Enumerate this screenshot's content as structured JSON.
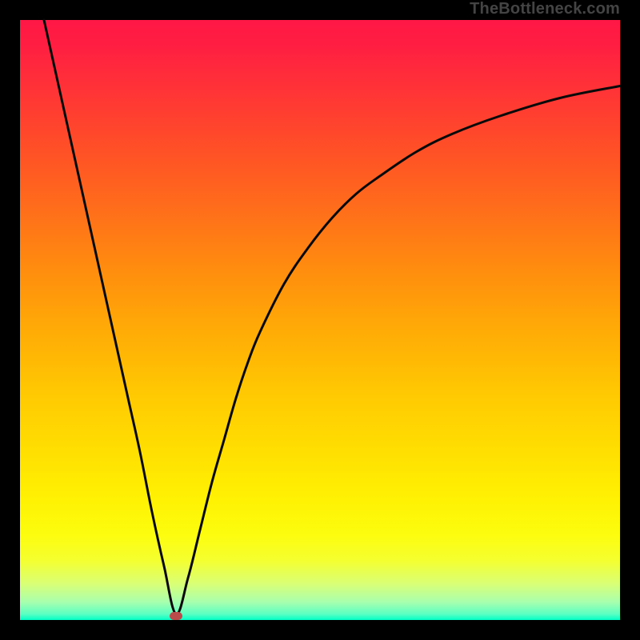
{
  "watermark": {
    "text": "TheBottleneck.com"
  },
  "chart_data": {
    "type": "line",
    "title": "",
    "xlabel": "",
    "ylabel": "",
    "xlim": [
      0,
      100
    ],
    "ylim": [
      0,
      100
    ],
    "grid": false,
    "legend": false,
    "background": "gradient-red-yellow-green-vertical",
    "series": [
      {
        "name": "left-branch",
        "x": [
          4,
          6,
          8,
          10,
          12,
          14,
          16,
          18,
          20,
          22,
          24,
          26
        ],
        "y": [
          100,
          91,
          82,
          73,
          64,
          55,
          46,
          37,
          28,
          18,
          9,
          1
        ]
      },
      {
        "name": "right-branch",
        "x": [
          26,
          28,
          30,
          32,
          34,
          36,
          38,
          40,
          44,
          48,
          52,
          56,
          60,
          66,
          72,
          80,
          90,
          100
        ],
        "y": [
          1,
          7,
          15,
          23,
          30,
          37,
          43,
          48,
          56,
          62,
          67,
          71,
          74,
          78,
          81,
          84,
          87,
          89
        ]
      }
    ],
    "marker": {
      "x": 26,
      "y": 0.7,
      "w": 2.2,
      "h": 1.4,
      "color": "#B94B4B"
    }
  },
  "colors": {
    "curve": "#0A0A0A",
    "frame": "#000000"
  }
}
